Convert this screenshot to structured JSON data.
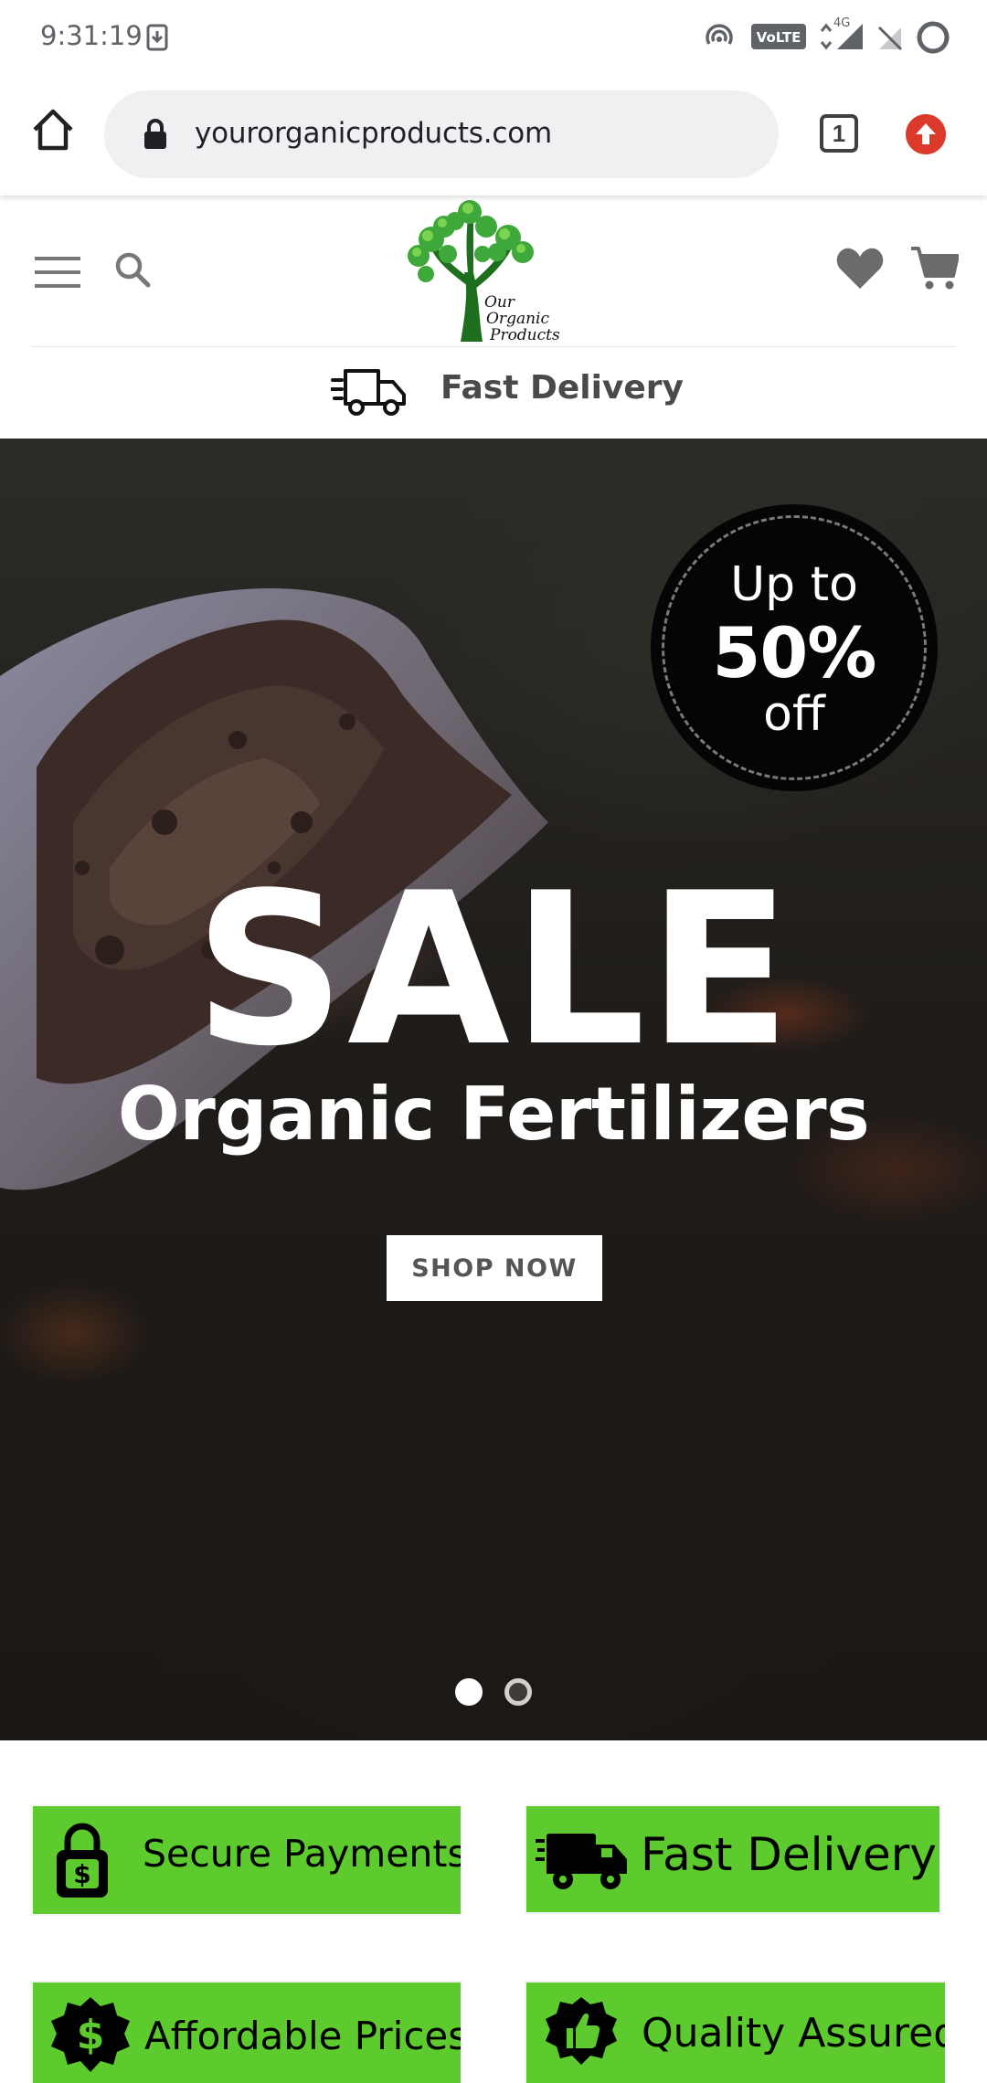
{
  "status_bar": {
    "time": "9:31:19",
    "icons": [
      "download-icon",
      "hotspot-icon",
      "volte-icon",
      "signal-4g-icon",
      "no-sim-icon",
      "loading-icon"
    ],
    "volte_label": "VoLTE",
    "network_label": "4G"
  },
  "browser": {
    "url": "yourorganicproducts.com",
    "tab_count": "1"
  },
  "header": {
    "logo_text_lines": [
      "Our",
      "Organic",
      "Products"
    ],
    "delivery_label": "Fast Delivery"
  },
  "hero": {
    "badge_line1": "Up to",
    "badge_line2": "50%",
    "badge_line3": "off",
    "title": "SALE",
    "subtitle": "Organic Fertilizers",
    "cta_label": "SHOP NOW",
    "slide_count": 2,
    "active_slide": 1
  },
  "features": {
    "secure": "Secure Payments",
    "fast": "Fast Delivery",
    "affordable": "Affordable Prices",
    "quality": "Quality Assured"
  },
  "colors": {
    "feature_green": "#5dca2e",
    "update_red": "#db3a2b",
    "url_bg": "#eef0f2",
    "hero_dark": "#1f1c19"
  }
}
